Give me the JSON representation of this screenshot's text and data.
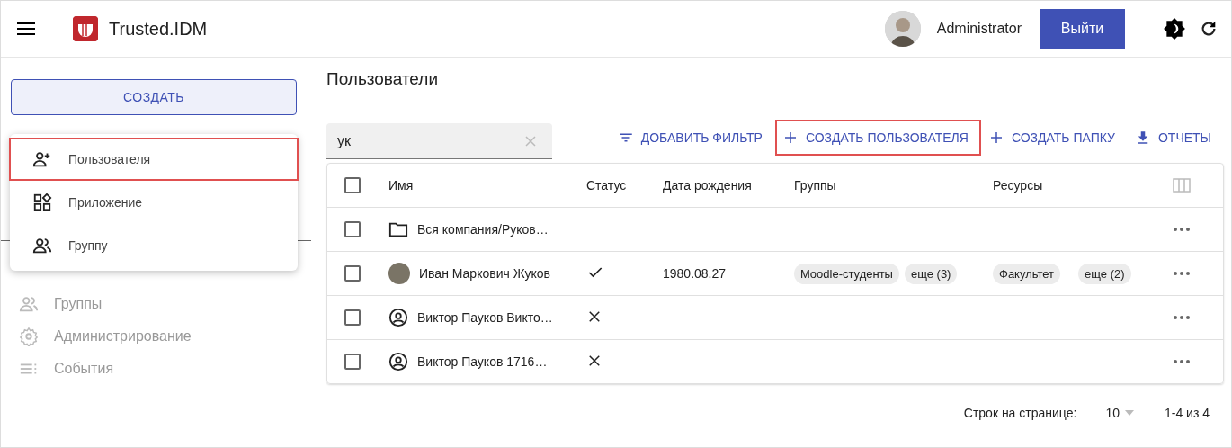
{
  "header": {
    "app_name": "Trusted.IDM",
    "user_name": "Administrator",
    "logout": "Выйти"
  },
  "sidebar": {
    "create_button": "СОЗДАТЬ",
    "create_menu": [
      {
        "label": "Пользователя",
        "kind": "user-add",
        "highlighted": true
      },
      {
        "label": "Приложение",
        "kind": "apps",
        "highlighted": false
      },
      {
        "label": "Группу",
        "kind": "group",
        "highlighted": false
      }
    ],
    "nav": [
      {
        "label": "Группы",
        "kind": "group",
        "selected": false
      },
      {
        "label": "Администрирование",
        "kind": "gear",
        "selected": false
      },
      {
        "label": "События",
        "kind": "list",
        "selected": false
      }
    ]
  },
  "page_title": "Пользователи",
  "search": {
    "value": "ук"
  },
  "actions": [
    {
      "label": "ДОБАВИТЬ ФИЛЬТР",
      "kind": "filter",
      "highlighted": false
    },
    {
      "label": "СОЗДАТЬ ПОЛЬЗОВАТЕЛЯ",
      "kind": "plus",
      "highlighted": true
    },
    {
      "label": "СОЗДАТЬ ПАПКУ",
      "kind": "plus",
      "highlighted": false
    },
    {
      "label": "ОТЧЕТЫ",
      "kind": "download",
      "highlighted": false
    }
  ],
  "table": {
    "select_all_checked": false,
    "columns": [
      "Имя",
      "Статус",
      "Дата рождения",
      "Группы",
      "Ресурсы"
    ],
    "rows": [
      {
        "kind": "folder",
        "checked": false,
        "name": "Вся компания/Руков…"
      },
      {
        "kind": "photo",
        "checked": false,
        "name": "Иван Маркович Жуков",
        "active": true,
        "birth_date": "1980.08.27",
        "groups": [
          "Moodle-студенты",
          "еще (3)"
        ],
        "resources": [
          "Факультет",
          "еще (2)"
        ]
      },
      {
        "kind": "user",
        "checked": false,
        "name": "Виктор Пауков Викто…",
        "active": false
      },
      {
        "kind": "user",
        "checked": false,
        "name": "Виктор Пауков 1716…",
        "active": false
      }
    ]
  },
  "pagination": {
    "rows_label": "Строк на странице:",
    "rows_value": "10",
    "range": "1-4 из 4"
  }
}
